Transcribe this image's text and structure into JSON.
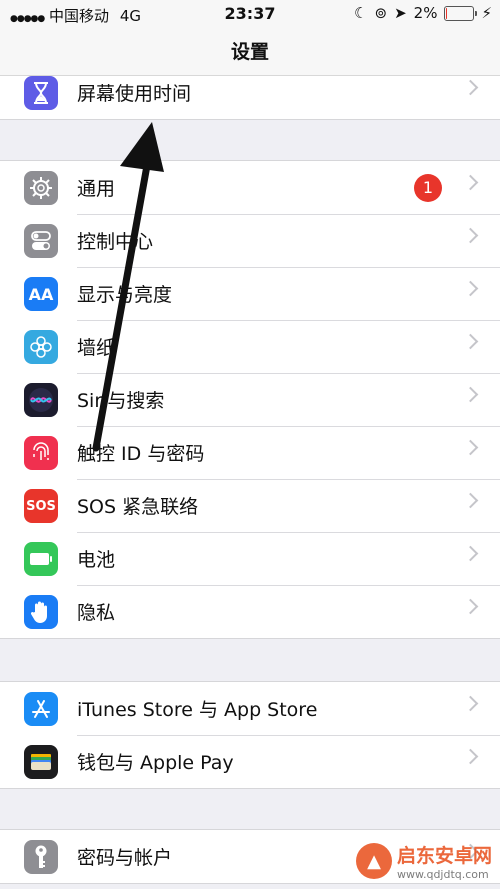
{
  "status": {
    "carrier": "中国移动",
    "network": "4G",
    "time": "23:37",
    "battery": "2%",
    "battery_level": 0.02
  },
  "nav": {
    "title": "设置"
  },
  "groups": {
    "g0": [
      {
        "label": "屏幕使用时间",
        "icon": "hourglass-icon",
        "color": "#5e5ce6"
      }
    ],
    "g1": [
      {
        "label": "通用",
        "icon": "gear-icon",
        "color": "#8e8e93",
        "badge": "1"
      },
      {
        "label": "控制中心",
        "icon": "toggle-icon",
        "color": "#8e8e93"
      },
      {
        "label": "显示与亮度",
        "icon": "text-size-icon",
        "color": "#1a7cf5",
        "glyph": "AA"
      },
      {
        "label": "墙纸",
        "icon": "flower-icon",
        "color": "#35a9e0"
      },
      {
        "label": "Siri与搜索",
        "icon": "siri-icon",
        "color": "#1c1c2e"
      },
      {
        "label": "触控 ID 与密码",
        "icon": "fingerprint-icon",
        "color": "#f0304f"
      },
      {
        "label": "SOS 紧急联络",
        "icon": "sos-icon",
        "color": "#e8352b",
        "glyph": "SOS"
      },
      {
        "label": "电池",
        "icon": "battery-icon",
        "color": "#34c759"
      },
      {
        "label": "隐私",
        "icon": "hand-icon",
        "color": "#1a7cf5"
      }
    ],
    "g2": [
      {
        "label": "iTunes Store 与 App Store",
        "icon": "app-store-icon",
        "color": "#1a8cf5"
      },
      {
        "label": "钱包与 Apple Pay",
        "icon": "wallet-icon",
        "color": "#1c1c1e"
      }
    ],
    "g3": [
      {
        "label": "密码与帐户",
        "icon": "key-icon",
        "color": "#8e8e93"
      }
    ]
  },
  "watermark": {
    "title": "启东安卓网",
    "url": "www.qdjdtq.com"
  },
  "colors": {
    "badge": "#e8352b",
    "background": "#efeff4"
  }
}
